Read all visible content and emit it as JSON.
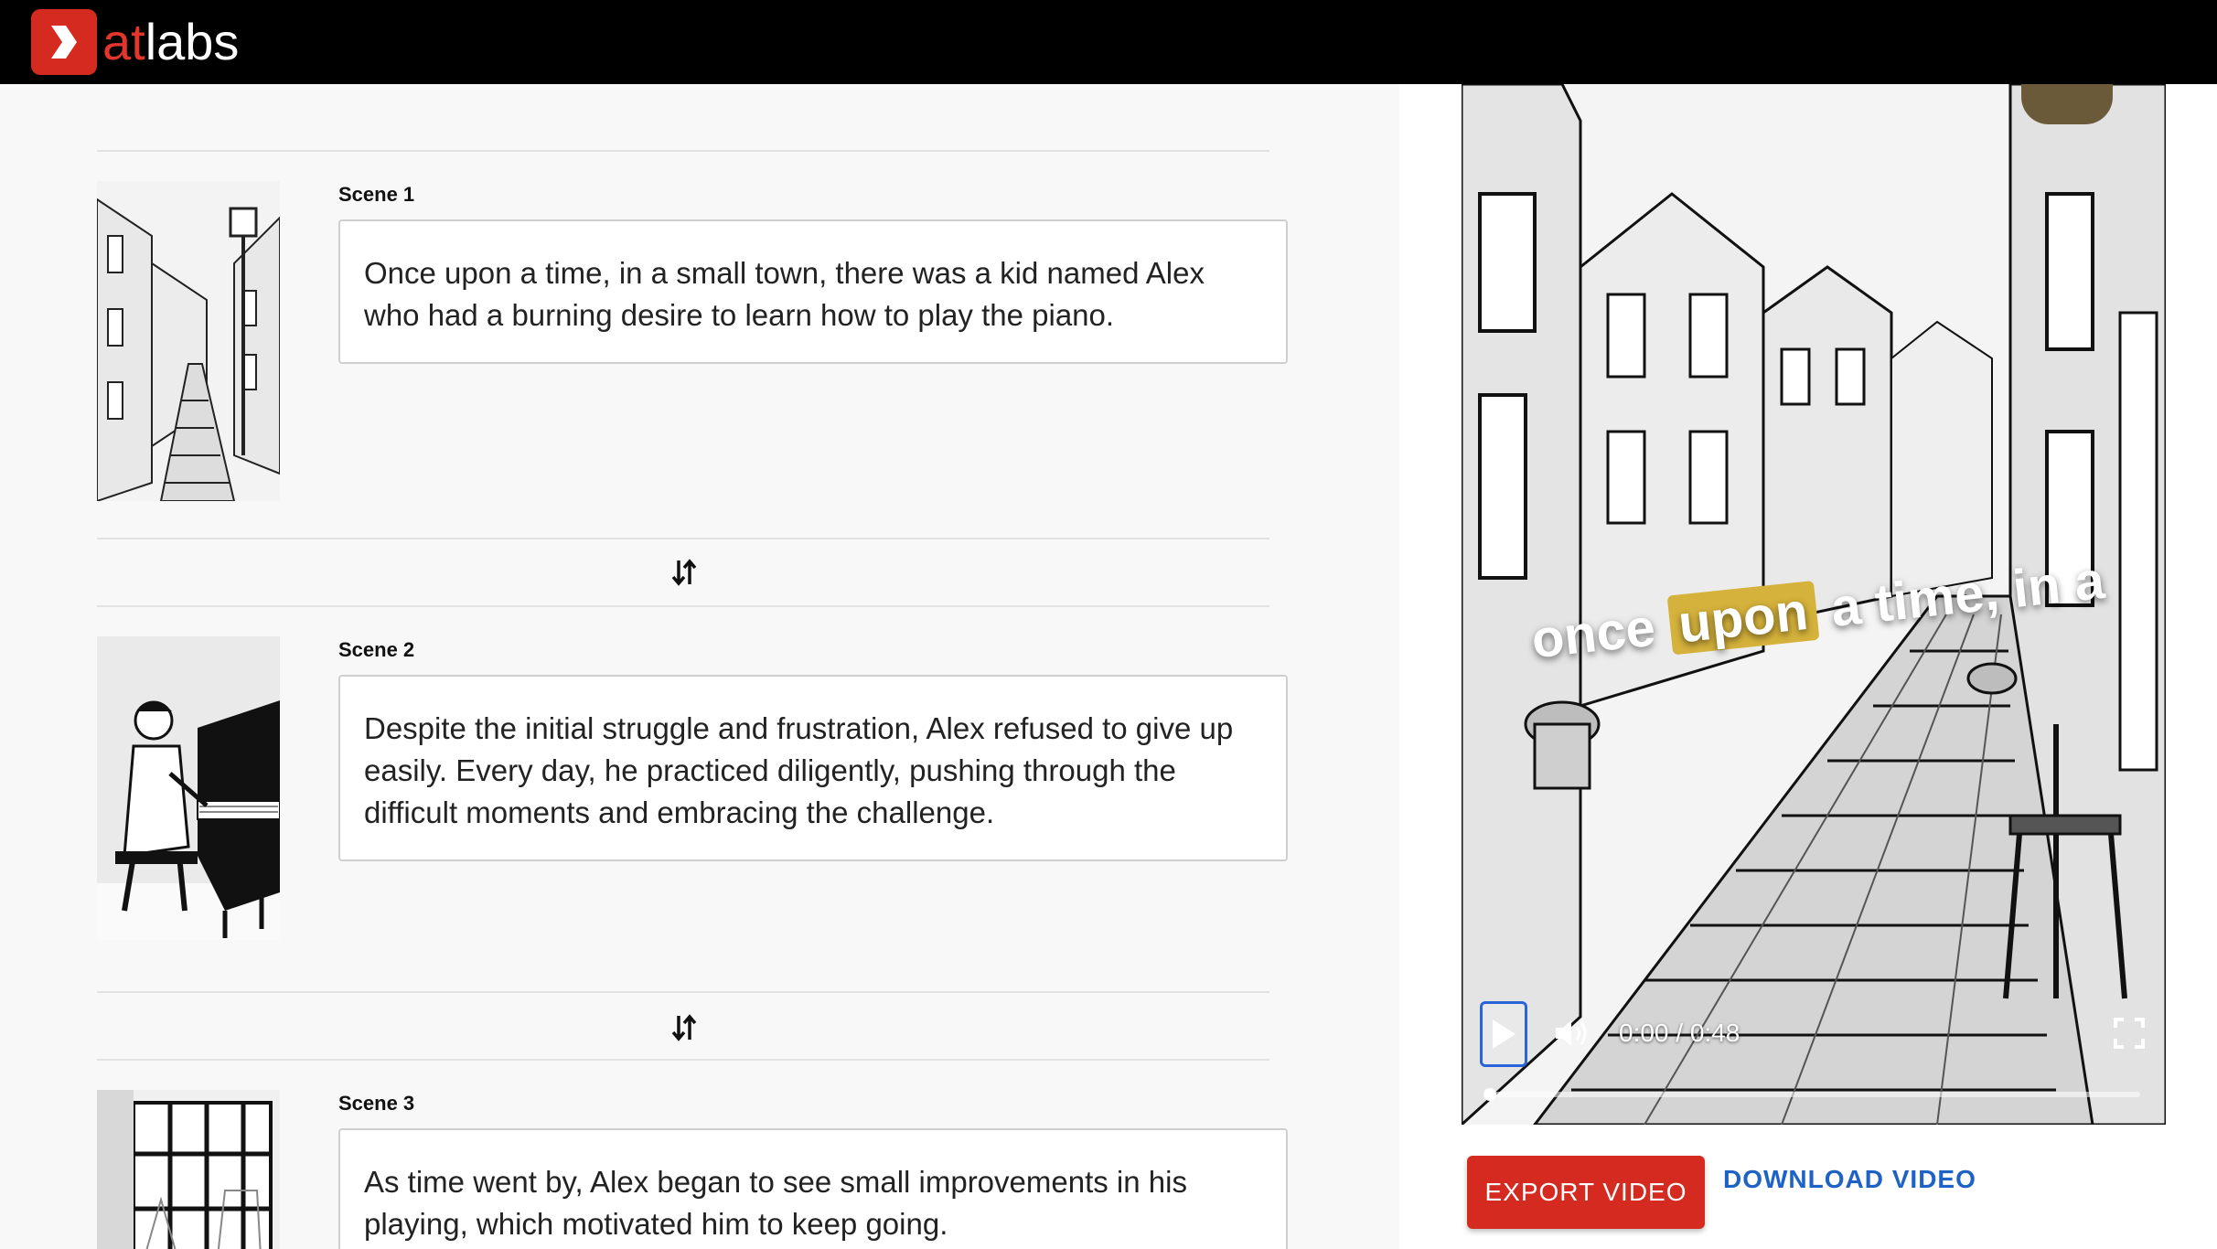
{
  "header": {
    "logo_prefix": "at",
    "logo_suffix": "labs"
  },
  "scenes": [
    {
      "label": "Scene 1",
      "text": "Once upon a time, in a small town, there was a kid named Alex who had a burning desire to learn how to play the piano."
    },
    {
      "label": "Scene 2",
      "text": "Despite the initial struggle and frustration, Alex refused to give up easily. Every day, he practiced diligently, pushing through the difficult moments and embracing the challenge."
    },
    {
      "label": "Scene 3",
      "text": "As time went by, Alex began to see small improvements in his playing, which motivated him to keep going."
    }
  ],
  "player": {
    "caption_before": "once ",
    "caption_highlight": "upon",
    "caption_after": " a time, in a",
    "time": "0:00 / 0:48",
    "progress": 0
  },
  "actions": {
    "export_label": "EXPORT VIDEO",
    "download_label": "DOWNLOAD VIDEO"
  },
  "icons": {
    "swap": "swap-vertical-icon",
    "play": "play-icon",
    "volume": "volume-icon",
    "fullscreen": "fullscreen-icon"
  },
  "colors": {
    "brand": "#d42a20",
    "link": "#1e62c6",
    "caption_highlight": "#d5b23b"
  }
}
